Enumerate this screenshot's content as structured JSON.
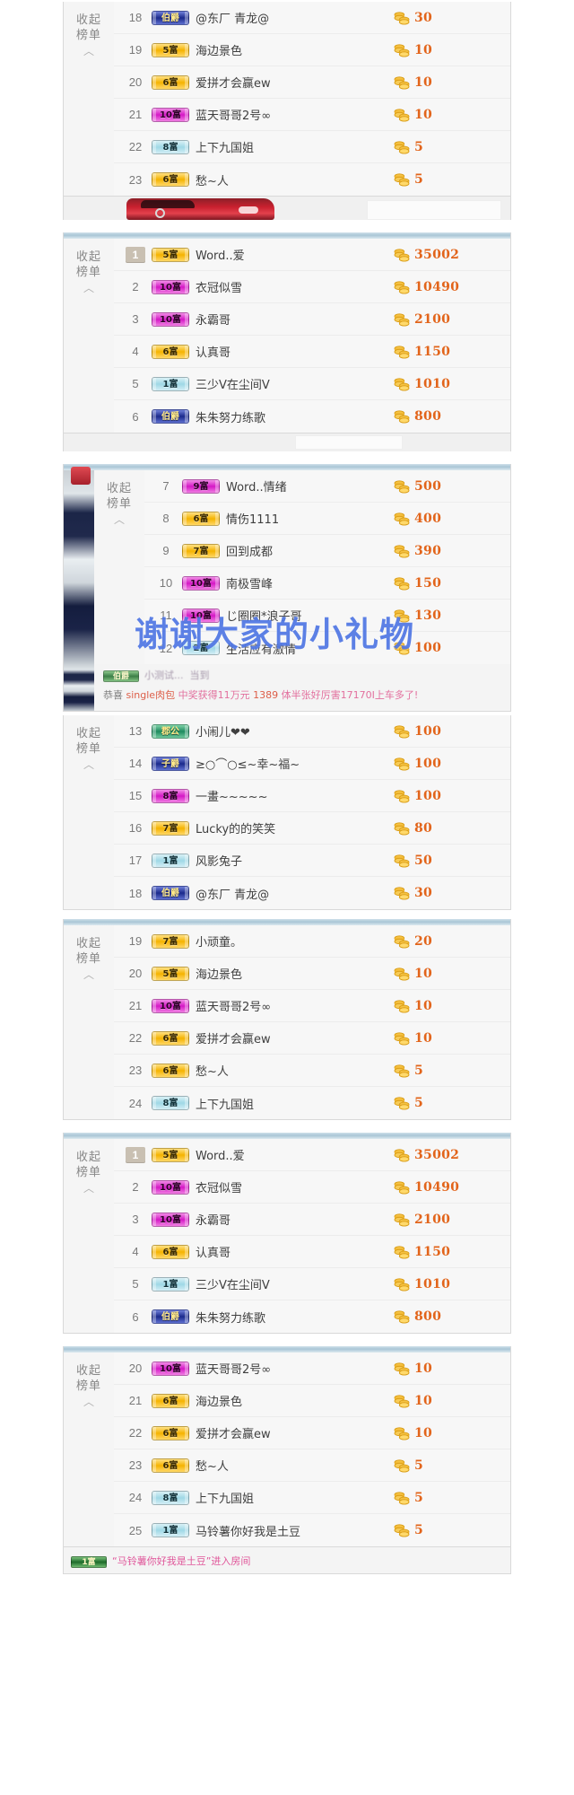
{
  "collapse": {
    "label_line1": "收起",
    "label_line2": "榜单",
    "caret": "︿"
  },
  "coin_icon": "coin-stack-icon",
  "blocks": [
    {
      "id": "block-1",
      "rows": [
        {
          "rank": "18",
          "badge": "伯爵",
          "badge_style": "navy",
          "name": "@东厂 青龙@",
          "score": "30"
        },
        {
          "rank": "19",
          "badge": "5富",
          "badge_style": "gold",
          "name": "海边景色",
          "score": "10"
        },
        {
          "rank": "20",
          "badge": "6富",
          "badge_style": "gold",
          "name": "爱拼才会赢ew",
          "score": "10"
        },
        {
          "rank": "21",
          "badge": "10富",
          "badge_style": "magenta",
          "name": "蓝天哥哥2号∞",
          "score": "10"
        },
        {
          "rank": "22",
          "badge": "8富",
          "badge_style": "cyan",
          "name": "上下九国姐",
          "score": "5"
        },
        {
          "rank": "23",
          "badge": "6富",
          "badge_style": "gold",
          "name": "愁~人",
          "score": "5"
        }
      ]
    },
    {
      "id": "block-2",
      "rows": [
        {
          "rank": "1",
          "badge": "5富",
          "badge_style": "gold",
          "name": "Word..爱",
          "score": "35002",
          "top": true
        },
        {
          "rank": "2",
          "badge": "10富",
          "badge_style": "magenta",
          "name": "衣冠似雪",
          "score": "10490"
        },
        {
          "rank": "3",
          "badge": "10富",
          "badge_style": "magenta",
          "name": "永霸哥",
          "score": "2100"
        },
        {
          "rank": "4",
          "badge": "6富",
          "badge_style": "gold",
          "name": "认真哥",
          "score": "1150"
        },
        {
          "rank": "5",
          "badge": "1富",
          "badge_style": "cyan",
          "name": "三少V在尘间V",
          "score": "1010"
        },
        {
          "rank": "6",
          "badge": "伯爵",
          "badge_style": "navy",
          "name": "朱朱努力练歌",
          "score": "800"
        }
      ]
    },
    {
      "id": "block-3",
      "rows": [
        {
          "rank": "7",
          "badge": "9富",
          "badge_style": "magenta",
          "name": "Word..情绪",
          "score": "500"
        },
        {
          "rank": "8",
          "badge": "6富",
          "badge_style": "gold",
          "name": "情伤1111",
          "score": "400"
        },
        {
          "rank": "9",
          "badge": "7富",
          "badge_style": "gold",
          "name": "回到成都",
          "score": "390"
        },
        {
          "rank": "10",
          "badge": "10富",
          "badge_style": "magenta",
          "name": "南极雪峰",
          "score": "150"
        },
        {
          "rank": "11",
          "badge": "10富",
          "badge_style": "magenta",
          "name": "じ圈圈*浪子哥",
          "score": "130"
        },
        {
          "rank": "12",
          "badge": "2富",
          "badge_style": "cyan",
          "name": "生活应有激情",
          "score": "100"
        }
      ]
    },
    {
      "id": "block-4",
      "rows": [
        {
          "rank": "13",
          "badge": "郡公",
          "badge_style": "teal",
          "name": "小闹儿❤❤",
          "score": "100"
        },
        {
          "rank": "14",
          "badge": "子爵",
          "badge_style": "navy",
          "name": "≥○⌒○≤~幸~福~",
          "score": "100"
        },
        {
          "rank": "15",
          "badge": "8富",
          "badge_style": "magenta",
          "name": "一畫~~~~~",
          "score": "100"
        },
        {
          "rank": "16",
          "badge": "7富",
          "badge_style": "gold",
          "name": "Lucky的的笑笑",
          "score": "80"
        },
        {
          "rank": "17",
          "badge": "1富",
          "badge_style": "cyan",
          "name": "风影兔子",
          "score": "50"
        },
        {
          "rank": "18",
          "badge": "伯爵",
          "badge_style": "navy",
          "name": "@东厂 青龙@",
          "score": "30"
        }
      ]
    },
    {
      "id": "block-5",
      "rows": [
        {
          "rank": "19",
          "badge": "7富",
          "badge_style": "gold",
          "name": "小顽童。",
          "score": "20"
        },
        {
          "rank": "20",
          "badge": "5富",
          "badge_style": "gold",
          "name": "海边景色",
          "score": "10"
        },
        {
          "rank": "21",
          "badge": "10富",
          "badge_style": "magenta",
          "name": "蓝天哥哥2号∞",
          "score": "10"
        },
        {
          "rank": "22",
          "badge": "6富",
          "badge_style": "gold",
          "name": "爱拼才会赢ew",
          "score": "10"
        },
        {
          "rank": "23",
          "badge": "6富",
          "badge_style": "gold",
          "name": "愁~人",
          "score": "5"
        },
        {
          "rank": "24",
          "badge": "8富",
          "badge_style": "cyan",
          "name": "上下九国姐",
          "score": "5"
        }
      ]
    },
    {
      "id": "block-6",
      "rows": [
        {
          "rank": "1",
          "badge": "5富",
          "badge_style": "gold",
          "name": "Word..爱",
          "score": "35002",
          "top": true
        },
        {
          "rank": "2",
          "badge": "10富",
          "badge_style": "magenta",
          "name": "衣冠似雪",
          "score": "10490"
        },
        {
          "rank": "3",
          "badge": "10富",
          "badge_style": "magenta",
          "name": "永霸哥",
          "score": "2100"
        },
        {
          "rank": "4",
          "badge": "6富",
          "badge_style": "gold",
          "name": "认真哥",
          "score": "1150"
        },
        {
          "rank": "5",
          "badge": "1富",
          "badge_style": "cyan",
          "name": "三少V在尘间V",
          "score": "1010"
        },
        {
          "rank": "6",
          "badge": "伯爵",
          "badge_style": "navy",
          "name": "朱朱努力练歌",
          "score": "800"
        }
      ]
    },
    {
      "id": "block-7",
      "rows": [
        {
          "rank": "20",
          "badge": "10富",
          "badge_style": "magenta",
          "name": "蓝天哥哥2号∞",
          "score": "10"
        },
        {
          "rank": "21",
          "badge": "6富",
          "badge_style": "gold",
          "name": "海边景色",
          "score": "10"
        },
        {
          "rank": "22",
          "badge": "6富",
          "badge_style": "gold",
          "name": "爱拼才会赢ew",
          "score": "10"
        },
        {
          "rank": "23",
          "badge": "6富",
          "badge_style": "gold",
          "name": "愁~人",
          "score": "5"
        },
        {
          "rank": "24",
          "badge": "8富",
          "badge_style": "cyan",
          "name": "上下九国姐",
          "score": "5"
        },
        {
          "rank": "25",
          "badge": "1富",
          "badge_style": "cyan",
          "name": "马铃薯你好我是土豆",
          "score": "5"
        }
      ]
    }
  ],
  "chat_overlay": {
    "faded_badge": "伯爵",
    "faded_name": "小测试...",
    "faded_action": "当到",
    "congrat_prefix": "恭喜",
    "congrat_user": "single肉包",
    "congrat_mid": "中奖获得11万元",
    "congrat_num": "1389",
    "congrat_suffix": "体半张好厉害17170I上车多了!",
    "watermark": "谢谢大家的小礼物"
  },
  "bottom_chat": {
    "badge": "1富",
    "text": "“马铃薯你好我是土豆”进入房间"
  }
}
